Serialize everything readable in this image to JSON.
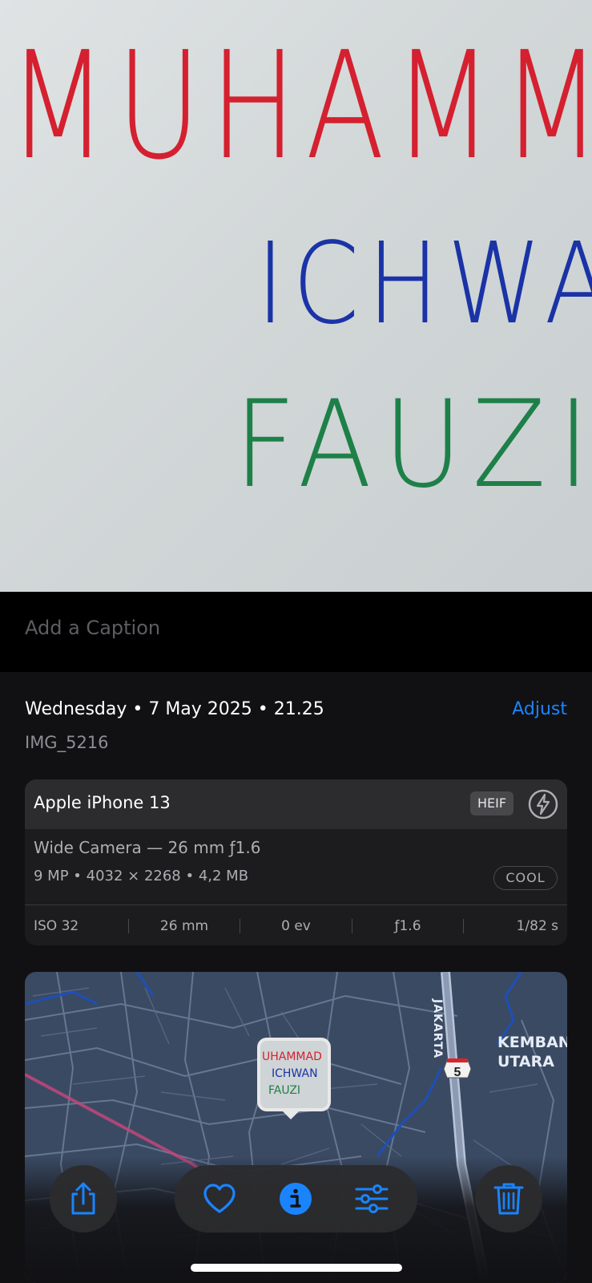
{
  "photo": {
    "handwriting": [
      "MUHAMMAD",
      "ICHWAN",
      "FAUZI"
    ],
    "colors": {
      "line1": "#d4202f",
      "line2": "#1a33a6",
      "line3": "#1e8049"
    }
  },
  "caption": {
    "placeholder": "Add a Caption",
    "value": ""
  },
  "details": {
    "date": "Wednesday • 7 May 2025 • 21.25",
    "adjust_label": "Adjust",
    "filename": "IMG_5216"
  },
  "camera": {
    "device": "Apple iPhone 13",
    "format_badge": "HEIF",
    "flash_icon": "flash-off-icon",
    "lens": "Wide Camera — 26 mm ƒ1.6",
    "specs": "9 MP  •  4032 × 2268  •  4,2 MB",
    "style_badge": "COOL",
    "exif": {
      "iso": "ISO 32",
      "focal": "26 mm",
      "exposure": "0 ev",
      "aperture": "ƒ1.6",
      "shutter": "1/82 s"
    }
  },
  "map": {
    "area_label_1": "KEMBANG",
    "area_label_2": "UTARA",
    "road_label": "JAKARTA",
    "route_number": "5",
    "thumbnail_text": [
      "UHAMMAD",
      "ICHWAN",
      "FAUZI"
    ]
  },
  "toolbar": {
    "share_icon": "share-icon",
    "favorite_icon": "heart-icon",
    "info_icon": "info-icon",
    "adjust_icon": "sliders-icon",
    "delete_icon": "trash-icon"
  },
  "accent_color": "#1a84ff"
}
